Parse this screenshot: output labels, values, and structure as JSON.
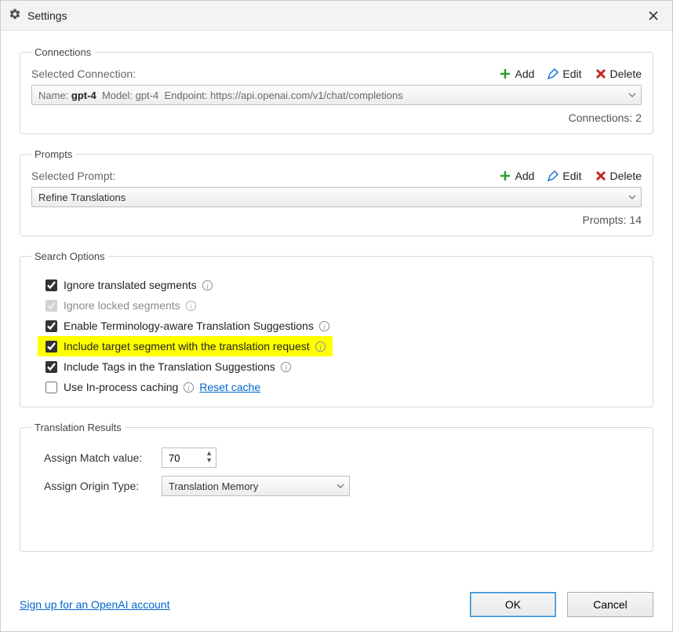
{
  "window": {
    "title": "Settings"
  },
  "connections": {
    "legend": "Connections",
    "selected_label": "Selected Connection:",
    "add": "Add",
    "edit": "Edit",
    "delete": "Delete",
    "dropdown": {
      "name_label": "Name:",
      "name_value": "gpt-4",
      "model_label": "Model:",
      "model_value": "gpt-4",
      "endpoint_label": "Endpoint:",
      "endpoint_value": "https://api.openai.com/v1/chat/completions"
    },
    "count": "Connections: 2"
  },
  "prompts": {
    "legend": "Prompts",
    "selected_label": "Selected Prompt:",
    "add": "Add",
    "edit": "Edit",
    "delete": "Delete",
    "dropdown_value": "Refine Translations",
    "count": "Prompts: 14"
  },
  "search": {
    "legend": "Search Options",
    "opt1": "Ignore translated segments",
    "opt2": "Ignore locked segments",
    "opt3": "Enable Terminology-aware Translation Suggestions",
    "opt4": "Include target segment with the translation request",
    "opt5": "Include Tags in the Translation Suggestions",
    "opt6": "Use In-process caching",
    "reset_cache": "Reset cache"
  },
  "results": {
    "legend": "Translation Results",
    "match_label": "Assign Match value:",
    "match_value": "70",
    "origin_label": "Assign Origin Type:",
    "origin_value": "Translation Memory"
  },
  "footer": {
    "signup": "Sign up for an OpenAI account",
    "ok": "OK",
    "cancel": "Cancel"
  }
}
